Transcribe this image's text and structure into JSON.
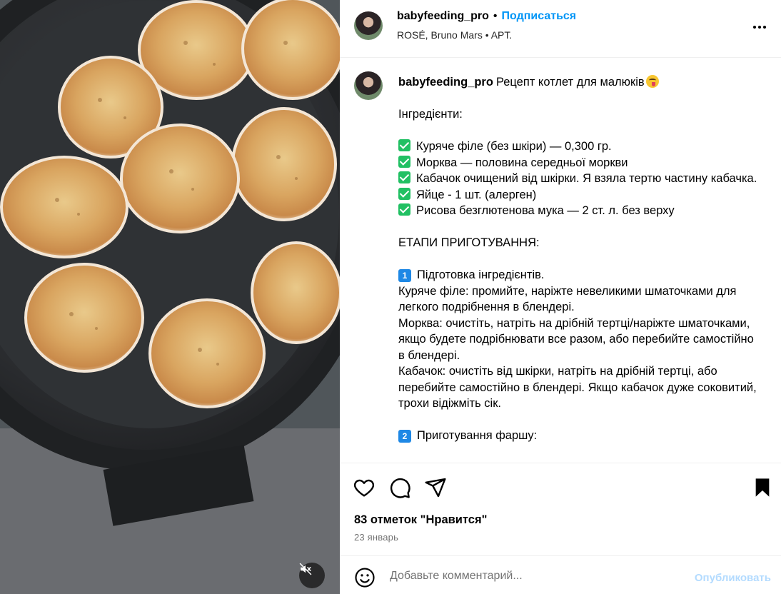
{
  "post": {
    "username": "babyfeeding_pro",
    "separator": "•",
    "follow_label": "Подписаться",
    "audio": "ROSÉ, Bruno Mars • APT.",
    "more_icon": "more-horizontal-icon"
  },
  "caption": {
    "username": "babyfeeding_pro",
    "title": "Рецепт котлет для малюків",
    "ingredients_heading": "Інгредієнти:",
    "ingredients": [
      "Куряче філе (без шкіри) — 0,300 гр.",
      "Морква — половина середньої моркви",
      "Кабачок очищений від шкірки. Я взяла тертю частину кабачка.",
      "Яйце - 1 шт. (алерген)",
      "Рисова безглютенова мука — 2 ст. л. без верху"
    ],
    "stages_heading": "ЕТАПИ ПРИГОТУВАННЯ:",
    "step1_num": "1",
    "step1_title": "Підготовка інгредієнтів.",
    "step1_lines": [
      "Куряче філе: промийте, наріжте невеликими шматочками для легкого подрібнення в блендері.",
      "Морква: очистіть, натріть на дрібній тертці/наріжте шматочками, якщо будете подрібнювати все разом, або перебийте самостійно в блендері.",
      "Кабачок: очистіть від шкірки, натріть на дрібній тертці, або перебийте самостійно в блендері. Якщо кабачок дуже соковитий, трохи відіжміть сік."
    ],
    "step2_num": "2",
    "step2_title": "Приготування фаршу:"
  },
  "actions": {
    "like_icon": "heart-icon",
    "comment_icon": "comment-icon",
    "share_icon": "share-icon",
    "save_icon": "bookmark-icon",
    "likes_text": "83 отметок \"Нравится\"",
    "date": "23 январь"
  },
  "comment": {
    "emoji_icon": "smile-icon",
    "placeholder": "Добавьте комментарий...",
    "publish_label": "Опубликовать"
  },
  "media": {
    "mute_icon": "muted-speaker-icon"
  },
  "colors": {
    "accent": "#0095f6",
    "publish_disabled": "#b3dbff",
    "check": "#21c063",
    "number_badge": "#1e88e5"
  }
}
